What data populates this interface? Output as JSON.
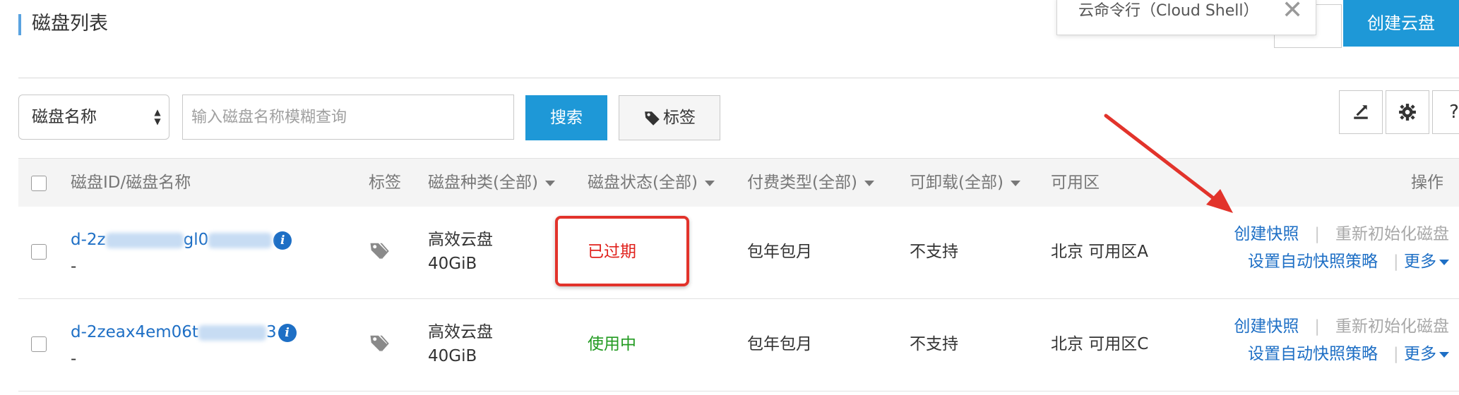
{
  "page": {
    "title": "磁盘列表"
  },
  "header": {
    "cloud_shell_label": "云命令行（Cloud Shell）",
    "close_symbol": "✕",
    "create_disk_label": "创建云盘"
  },
  "filter": {
    "select_value": "磁盘名称",
    "search_placeholder": "输入磁盘名称模糊查询",
    "search_label": "搜索",
    "tag_label": "标签",
    "help_label": "?"
  },
  "table": {
    "columns": {
      "disk_id_name": "磁盘ID/磁盘名称",
      "tags": "标签",
      "disk_type": "磁盘种类(全部)",
      "disk_status": "磁盘状态(全部)",
      "billing": "付费类型(全部)",
      "detachable": "可卸载(全部)",
      "zone": "可用区",
      "actions": "操作"
    },
    "rows": [
      {
        "id_prefix": "d-2z",
        "id_mid": "gl0",
        "id_suffix": "",
        "name": "-",
        "disk_type": "高效云盘",
        "size": "40GiB",
        "status": "已过期",
        "billing": "包年包月",
        "detachable": "不支持",
        "zone": "北京 可用区A",
        "actions": {
          "snapshot": "创建快照",
          "reinit": "重新初始化磁盘",
          "auto_policy": "设置自动快照策略",
          "more": "更多"
        }
      },
      {
        "id_prefix": "d-2zeax4em06t",
        "id_mid": "",
        "id_suffix": "3",
        "name": "-",
        "disk_type": "高效云盘",
        "size": "40GiB",
        "status": "使用中",
        "billing": "包年包月",
        "detachable": "不支持",
        "zone": "北京 可用区C",
        "actions": {
          "snapshot": "创建快照",
          "reinit": "重新初始化磁盘",
          "auto_policy": "设置自动快照策略",
          "more": "更多"
        }
      }
    ]
  },
  "colors": {
    "accent": "#1e98d7",
    "link": "#1e6fc5",
    "expired": "#e0211c",
    "running": "#239b22",
    "annotation": "#e2332b"
  }
}
